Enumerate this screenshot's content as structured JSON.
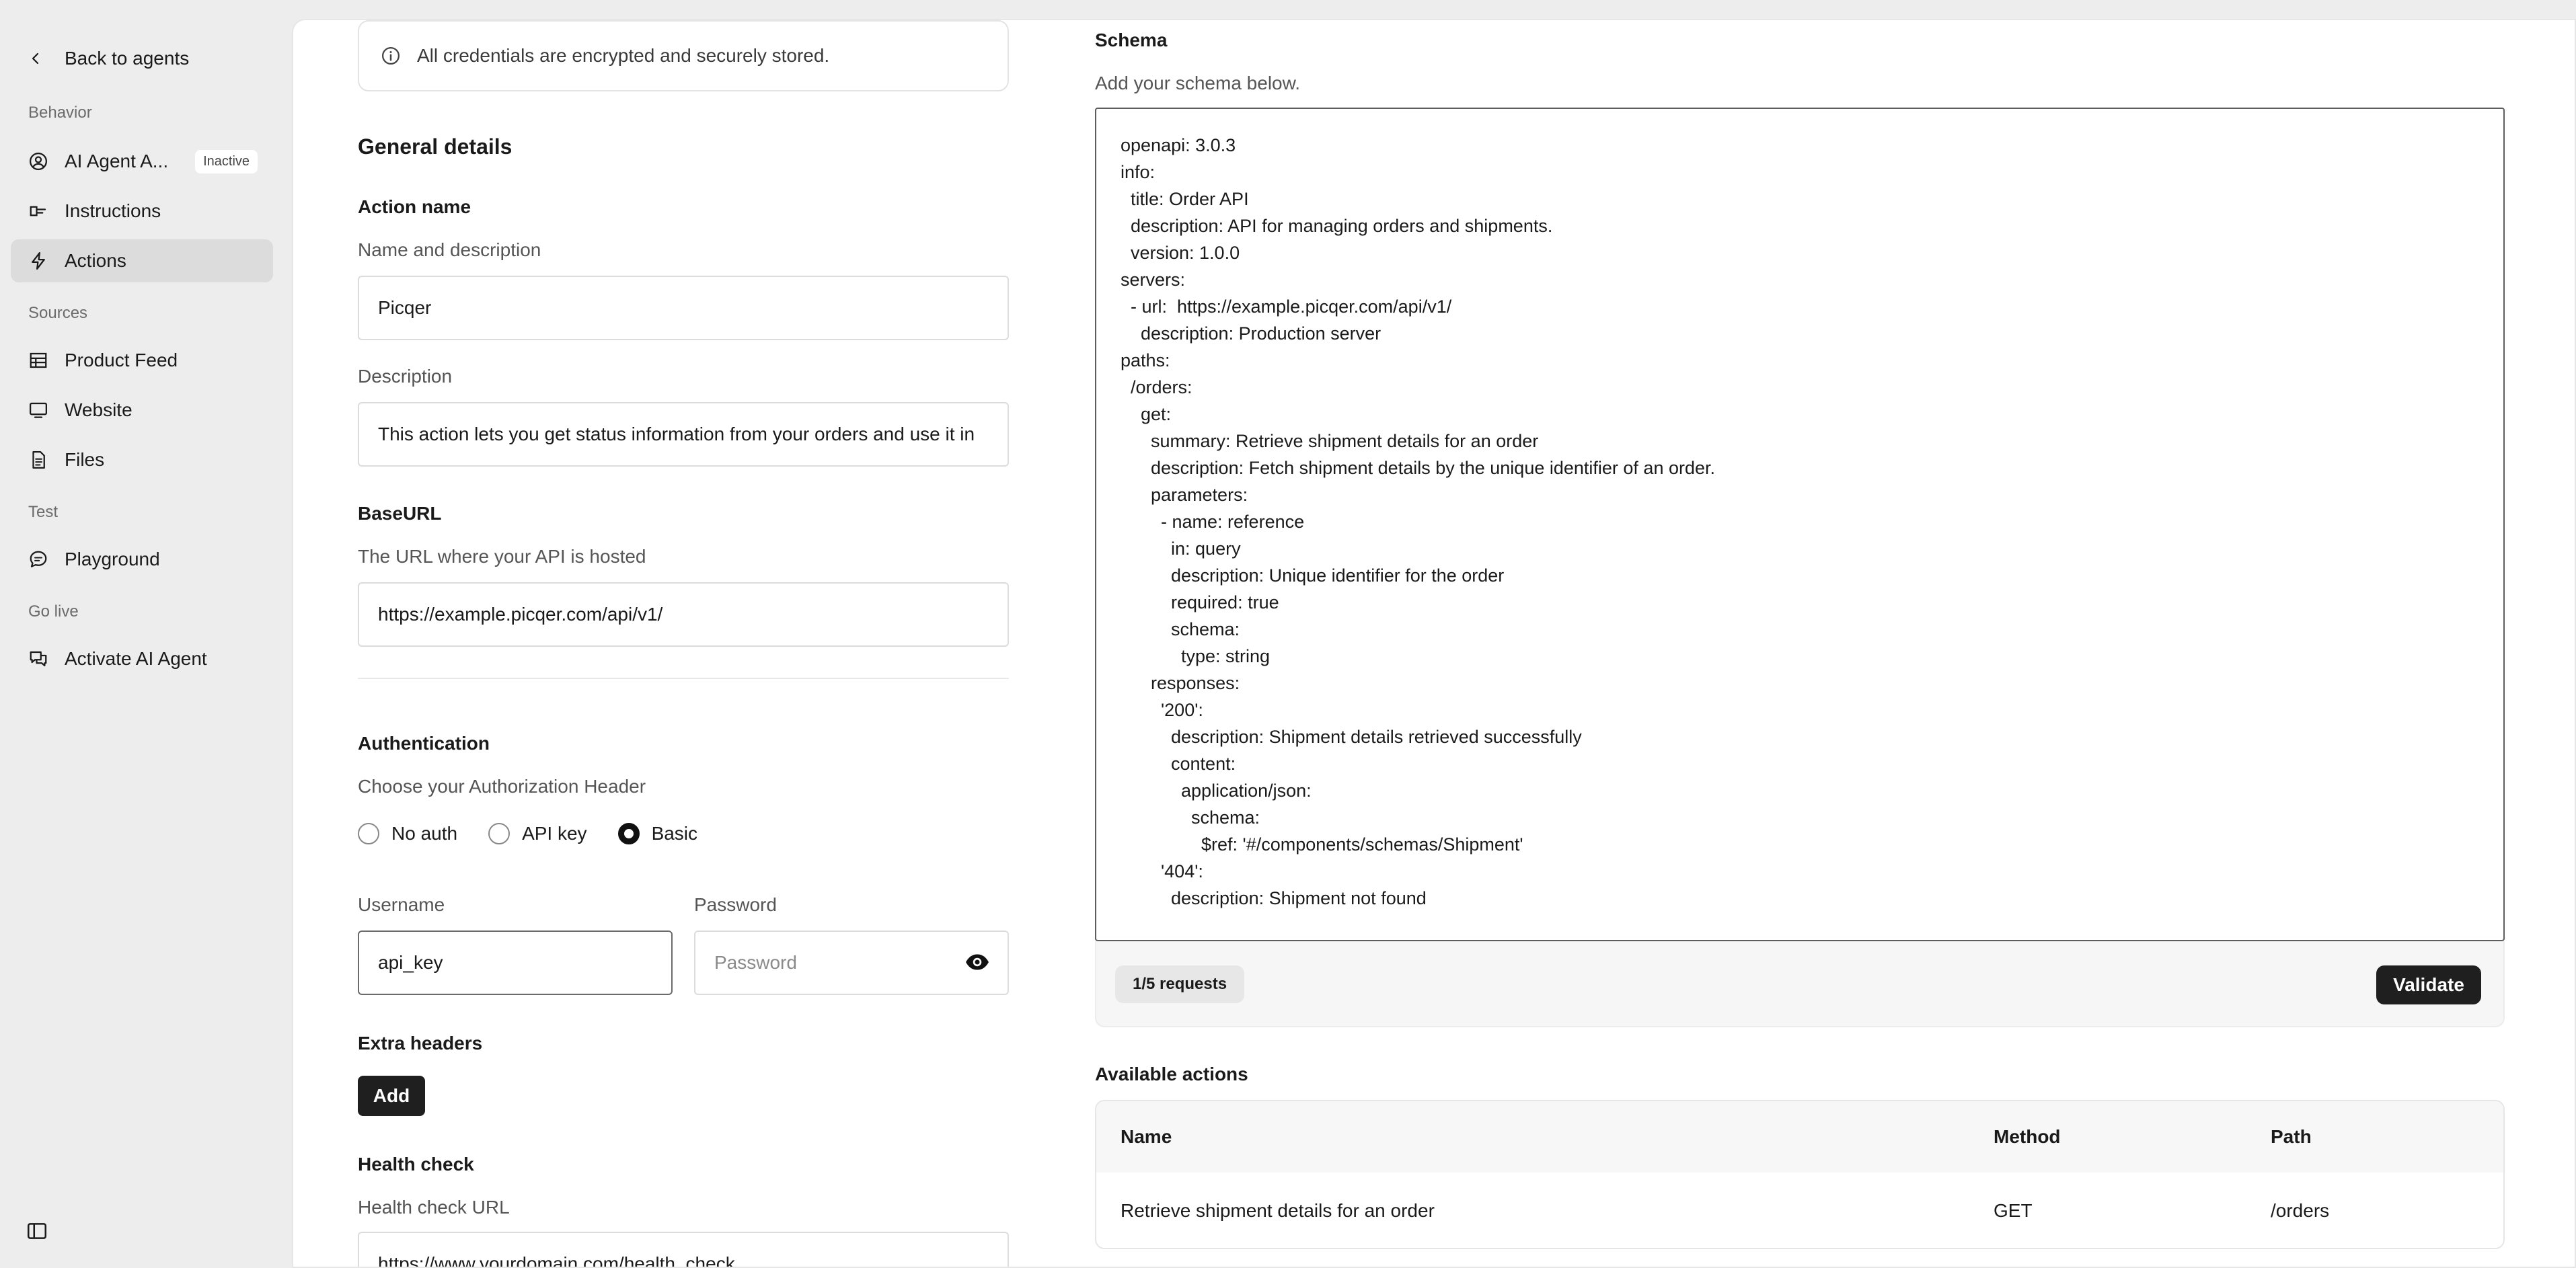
{
  "sidebar": {
    "back_label": "Back to agents",
    "sections": {
      "behavior": "Behavior",
      "sources": "Sources",
      "test": "Test",
      "go_live": "Go live"
    },
    "items": [
      {
        "label": "AI Agent A...",
        "badge": "Inactive",
        "icon": "user-circle-icon"
      },
      {
        "label": "Instructions",
        "icon": "instructions-icon"
      },
      {
        "label": "Actions",
        "icon": "lightning-icon",
        "active": true
      },
      {
        "label": "Product Feed",
        "icon": "table-icon"
      },
      {
        "label": "Website",
        "icon": "monitor-icon"
      },
      {
        "label": "Files",
        "icon": "file-icon"
      },
      {
        "label": "Playground",
        "icon": "chat-icon"
      },
      {
        "label": "Activate AI Agent",
        "icon": "chats-icon"
      }
    ]
  },
  "notice": {
    "text": "All credentials are encrypted and securely stored."
  },
  "general": {
    "title": "General details",
    "action_name": {
      "heading": "Action name",
      "label": "Name and description",
      "value": "Picqer"
    },
    "description": {
      "label": "Description",
      "value": "This action lets you get status information from your orders and use it in"
    },
    "baseurl": {
      "heading": "BaseURL",
      "label": "The URL where your API is hosted",
      "value": "https://example.picqer.com/api/v1/"
    }
  },
  "auth": {
    "heading": "Authentication",
    "label": "Choose your Authorization Header",
    "options": [
      "No auth",
      "API key",
      "Basic"
    ],
    "selected": "Basic",
    "username": {
      "label": "Username",
      "value": "api_key"
    },
    "password": {
      "label": "Password",
      "placeholder": "Password"
    }
  },
  "extra_headers": {
    "heading": "Extra headers",
    "add_label": "Add"
  },
  "health": {
    "heading": "Health check",
    "label": "Health check URL",
    "value": "https://www.yourdomain.com/health_check"
  },
  "schema": {
    "title": "Schema",
    "subtitle": "Add your schema below.",
    "content": "openapi: 3.0.3\ninfo:\n  title: Order API\n  description: API for managing orders and shipments.\n  version: 1.0.0\nservers:\n  - url:  https://example.picqer.com/api/v1/\n    description: Production server\npaths:\n  /orders:\n    get:\n      summary: Retrieve shipment details for an order\n      description: Fetch shipment details by the unique identifier of an order.\n      parameters:\n        - name: reference\n          in: query\n          description: Unique identifier for the order\n          required: true\n          schema:\n            type: string\n      responses:\n        '200':\n          description: Shipment details retrieved successfully\n          content:\n            application/json:\n              schema:\n                $ref: '#/components/schemas/Shipment'\n        '404':\n          description: Shipment not found",
    "requests": "1/5 requests",
    "validate_label": "Validate"
  },
  "available_actions": {
    "title": "Available actions",
    "columns": [
      "Name",
      "Method",
      "Path"
    ],
    "rows": [
      {
        "name": "Retrieve shipment details for an order",
        "method": "GET",
        "path": "/orders"
      }
    ]
  }
}
